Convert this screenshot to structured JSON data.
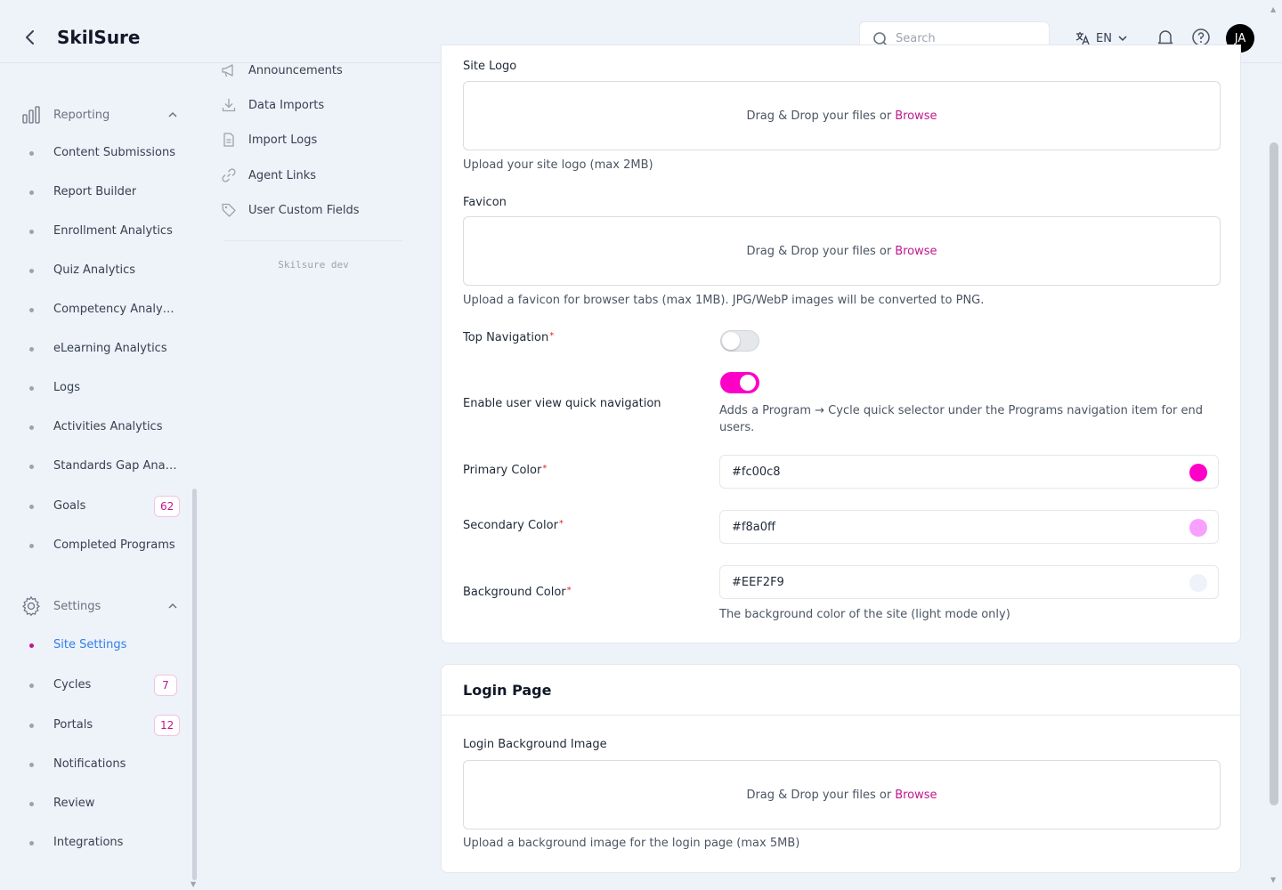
{
  "header": {
    "brand": "SkilSure",
    "search_placeholder": "Search",
    "language": "EN",
    "avatar_initials": "JA"
  },
  "sidebar": {
    "reporting": {
      "label": "Reporting",
      "items": [
        {
          "label": "Content Submissions"
        },
        {
          "label": "Report Builder"
        },
        {
          "label": "Enrollment Analytics"
        },
        {
          "label": "Quiz Analytics"
        },
        {
          "label": "Competency Analytics"
        },
        {
          "label": "eLearning Analytics"
        },
        {
          "label": "Logs"
        },
        {
          "label": "Activities Analytics"
        },
        {
          "label": "Standards Gap Analysis"
        },
        {
          "label": "Goals",
          "badge": "62"
        },
        {
          "label": "Completed Programs"
        }
      ]
    },
    "settings": {
      "label": "Settings",
      "items": [
        {
          "label": "Site Settings",
          "active": true
        },
        {
          "label": "Cycles",
          "badge": "7"
        },
        {
          "label": "Portals",
          "badge": "12"
        },
        {
          "label": "Notifications"
        },
        {
          "label": "Review"
        },
        {
          "label": "Integrations"
        }
      ]
    }
  },
  "submenu": {
    "items": [
      {
        "label": "Announcements"
      },
      {
        "label": "Data Imports"
      },
      {
        "label": "Import Logs"
      },
      {
        "label": "Agent Links"
      },
      {
        "label": "User Custom Fields"
      }
    ],
    "env_label": "Skilsure dev"
  },
  "site_settings": {
    "site_logo": {
      "label": "Site Logo",
      "drop_text": "Drag & Drop your files or",
      "browse": "Browse",
      "help": "Upload your site logo (max 2MB)"
    },
    "favicon": {
      "label": "Favicon",
      "drop_text": "Drag & Drop your files or",
      "browse": "Browse",
      "help": "Upload a favicon for browser tabs (max 1MB). JPG/WebP images will be converted to PNG."
    },
    "top_navigation": {
      "label": "Top Navigation",
      "required": "*",
      "enabled": false
    },
    "quick_navigation": {
      "label": "Enable user view quick navigation",
      "enabled": true,
      "help_line1": "Adds a Program → Cycle quick selector under the Programs navigation item for end",
      "help_line2": "users."
    },
    "primary_color": {
      "label": "Primary Color",
      "required": "*",
      "value": "#fc00c8",
      "swatch": "#fc00c8"
    },
    "secondary_color": {
      "label": "Secondary Color",
      "required": "*",
      "value": "#f8a0ff",
      "swatch": "#f8a0ff"
    },
    "background_color": {
      "label": "Background Color",
      "required": "*",
      "value": "#EEF2F9",
      "swatch": "#EEF2F9",
      "help": "The background color of the site (light mode only)"
    }
  },
  "login_page": {
    "title": "Login Page",
    "background_image": {
      "label": "Login Background Image",
      "drop_text": "Drag & Drop your files or",
      "browse": "Browse",
      "help": "Upload a background image for the login page (max 5MB)"
    }
  },
  "colors": {
    "accent": "#c0178c",
    "brand_pink": "#fc00c8",
    "active_link": "#2f80ed"
  }
}
